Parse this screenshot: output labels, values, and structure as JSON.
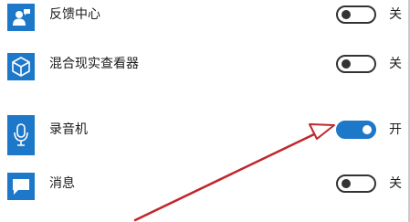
{
  "apps": [
    {
      "name": "反馈中心",
      "icon": "feedback-hub-icon",
      "enabled": false,
      "state_label": "关"
    },
    {
      "name": "混合现实查看器",
      "icon": "mixed-reality-viewer-icon",
      "enabled": false,
      "state_label": "关"
    },
    {
      "name": "录音机",
      "icon": "voice-recorder-icon",
      "enabled": true,
      "state_label": "开"
    },
    {
      "name": "消息",
      "icon": "messaging-icon",
      "enabled": false,
      "state_label": "关"
    }
  ],
  "colors": {
    "accent": "#1e78c9",
    "annotation_arrow": "#c0262b"
  }
}
